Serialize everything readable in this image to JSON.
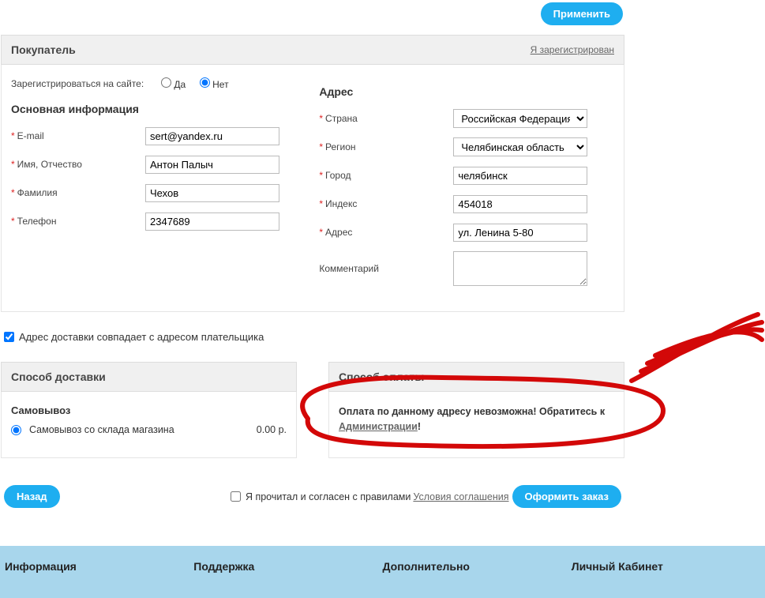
{
  "apply_button": "Применить",
  "buyer_section": {
    "title": "Покупатель",
    "registered_link": "Я зарегистрирован"
  },
  "register": {
    "label": "Зарегистрироваться на сайте:",
    "yes": "Да",
    "no": "Нет"
  },
  "main_info_heading": "Основная информация",
  "fields": {
    "email": {
      "label": "E-mail",
      "value": "sert@yandex.ru"
    },
    "name": {
      "label": "Имя, Отчество",
      "value": "Антон Палыч"
    },
    "surname": {
      "label": "Фамилия",
      "value": "Чехов"
    },
    "phone": {
      "label": "Телефон",
      "value": "2347689"
    }
  },
  "address_heading": "Адрес",
  "addr": {
    "country": {
      "label": "Страна",
      "value": "Российская Федерация"
    },
    "region": {
      "label": "Регион",
      "value": "Челябинская область"
    },
    "city": {
      "label": "Город",
      "value": "челябинск"
    },
    "index": {
      "label": "Индекс",
      "value": "454018"
    },
    "address": {
      "label": "Адрес",
      "value": "ул. Ленина 5-80"
    },
    "comment": {
      "label": "Комментарий",
      "value": ""
    }
  },
  "same_address": "Адрес доставки совпадает с адресом плательщика",
  "delivery_heading": "Способ доставки",
  "payment_heading": "Способ оплаты",
  "delivery": {
    "pickup_title": "Самовывоз",
    "pickup_option": "Самовывоз со склада магазина",
    "price": "0.00 р."
  },
  "payment_msg": {
    "text1": "Оплата по данному адресу невозможна! Обратитесь к",
    "link": "Администрации",
    "text2": "!"
  },
  "back_button": "Назад",
  "agree_text": "Я прочитал и согласен с правилами",
  "terms_link": "Условия соглашения",
  "submit_button": "Оформить заказ",
  "footer": {
    "info": "Информация",
    "support": "Поддержка",
    "more": "Дополнительно",
    "cabinet": "Личный Кабинет"
  }
}
